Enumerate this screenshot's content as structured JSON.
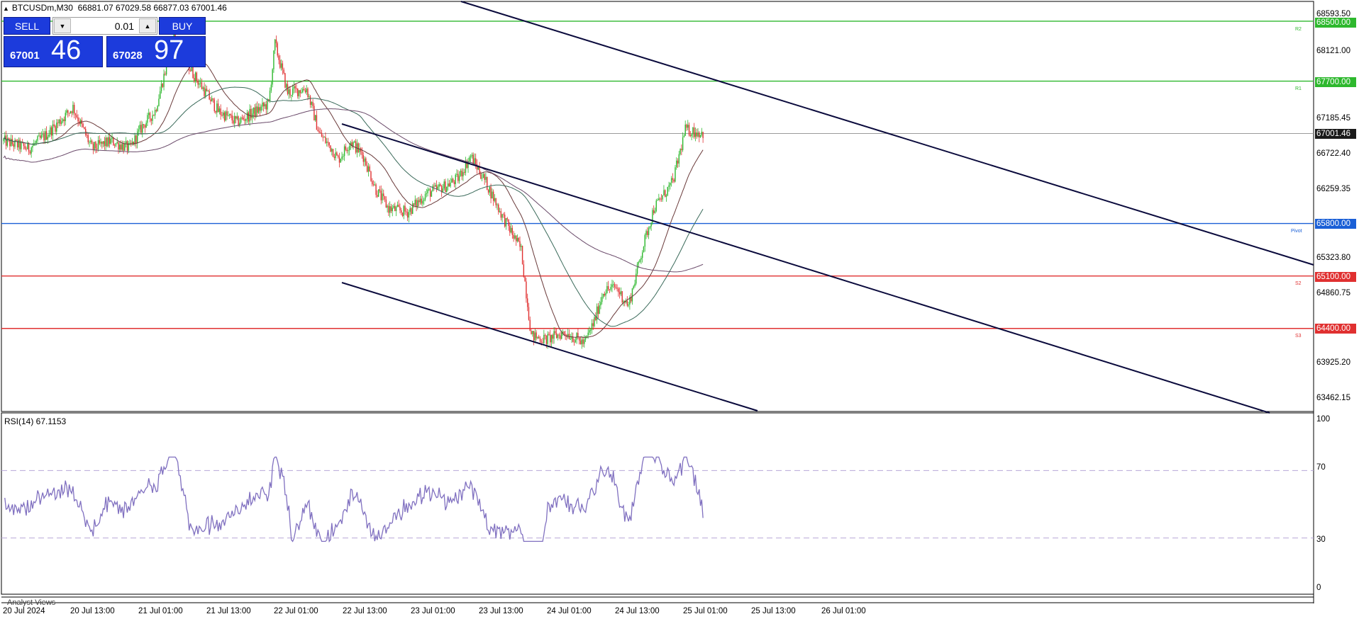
{
  "symbol": {
    "name_tf": "BTCUSDm,M30",
    "ohlc": "66881.07 67029.58 66877.03 67001.46"
  },
  "trade_panel": {
    "sell_label": "SELL",
    "buy_label": "BUY",
    "lot": "0.01",
    "sell_small": "67001",
    "sell_big": "46",
    "buy_small": "67028",
    "buy_big": "97"
  },
  "price_axis": [
    "68593.50",
    "68121.00",
    "67185.45",
    "66722.40",
    "66259.35",
    "65323.80",
    "64860.75",
    "63925.20",
    "63462.15"
  ],
  "levels": [
    {
      "name": "R2",
      "price": "68500.00",
      "color": "#2eb82e"
    },
    {
      "name": "R1",
      "price": "67700.00",
      "color": "#2eb82e"
    },
    {
      "name": "Pivot",
      "price": "65800.00",
      "color": "#1a5fd6"
    },
    {
      "name": "S2",
      "price": "65100.00",
      "color": "#e03030"
    },
    {
      "name": "S3",
      "price": "64400.00",
      "color": "#e03030"
    }
  ],
  "current_price": "67001.46",
  "time_axis": [
    "20 Jul 2024",
    "20 Jul 13:00",
    "21 Jul 01:00",
    "21 Jul 13:00",
    "22 Jul 01:00",
    "22 Jul 13:00",
    "23 Jul 01:00",
    "23 Jul 13:00",
    "24 Jul 01:00",
    "24 Jul 13:00",
    "25 Jul 01:00",
    "25 Jul 13:00",
    "26 Jul 01:00"
  ],
  "rsi": {
    "title": "RSI(14) 67.1153",
    "levels": [
      "100",
      "70",
      "30",
      "0"
    ]
  },
  "analyst_label": "Analyst Views",
  "colors": {
    "bull": "#2eb82e",
    "bear": "#e03030",
    "rsi": "#8070c0",
    "channel": "#0a0a3c"
  }
}
